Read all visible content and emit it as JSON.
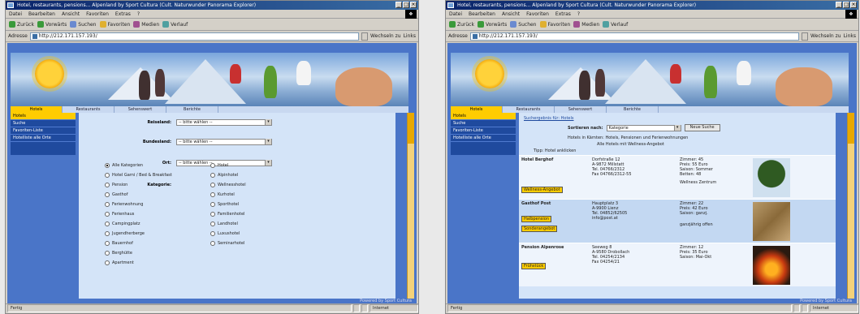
{
  "window_a": {
    "title": "Hotel, restaurants, pensions... Alpenland by Sport Cultura (Cult. Naturwunder Panorama Explorer)",
    "menu": [
      "Datei",
      "Bearbeiten",
      "Ansicht",
      "Favoriten",
      "Extras",
      "?"
    ],
    "toolbar": [
      "Zurück",
      "Vorwärts",
      "Suchen",
      "Favoriten",
      "Medien",
      "Verlauf"
    ],
    "address_label": "Adresse",
    "address_value": "http://212.171.157.193/",
    "go_label": "Wechseln zu",
    "links_label": "Links",
    "nav_tabs": [
      "Hotels",
      "Restaurants",
      "Sehenswert",
      "Berichte"
    ],
    "sidebar": [
      "Hotels",
      "Suche",
      "Favoriten-Liste",
      "Hotelliste alle Orte"
    ],
    "form": {
      "fields": [
        {
          "label": "Reiseland:",
          "value": "-- bitte wählen --"
        },
        {
          "label": "Bundesland:",
          "value": "-- bitte wählen --"
        },
        {
          "label": "Ort:",
          "value": "-- bitte wählen --"
        }
      ],
      "category_label": "Kategorie:",
      "radios_left": [
        "Alle Kategorien",
        "Hotel Garni / Bed & Breakfast",
        "Pension",
        "Gasthof",
        "Ferienwohnung",
        "Ferienhaus",
        "Campingplatz",
        "Jugendherberge",
        "Bauernhof",
        "Berghütte",
        "Apartment"
      ],
      "radios_right": [
        "Hotel",
        "Alpinhotel",
        "Wellnesshotel",
        "Kurhotel",
        "Sporthotel",
        "Familienhotel",
        "Landhotel",
        "Luxushotel",
        "Seminarhotel"
      ]
    },
    "footer": "Powered by Sport Cultura",
    "status": [
      "Fertig",
      "Internet"
    ]
  },
  "window_b": {
    "title": "Hotel, restaurants, pensions... Alpenland by Sport Cultura (Cult. Naturwunder Panorama Explorer)",
    "menu": [
      "Datei",
      "Bearbeiten",
      "Ansicht",
      "Favoriten",
      "Extras",
      "?"
    ],
    "toolbar": [
      "Zurück",
      "Vorwärts",
      "Suchen",
      "Favoriten",
      "Medien",
      "Verlauf"
    ],
    "address_label": "Adresse",
    "address_value": "http://212.171.157.193/",
    "go_label": "Wechseln zu",
    "links_label": "Links",
    "nav_tabs": [
      "Hotels",
      "Restaurants",
      "Sehenswert",
      "Berichte"
    ],
    "sidebar": [
      "Hotels",
      "Suche",
      "Favoriten-Liste",
      "Hotelliste alle Orte"
    ],
    "breadcrumb": "Suchergebnis für: Hotels",
    "sort_label": "Sortieren nach:",
    "sort_value": "Kategorie",
    "new_search_label": "Neue Suche",
    "info_lines": [
      "Hotels in Kärnten: Hotels, Pensionen und Ferienwohnungen",
      "Alle Hotels mit Wellness-Angebot",
      "Tipp: Hotel anklicken"
    ],
    "listings": [
      {
        "name": "Hotel Berghof",
        "tag": "Wellness-Angebot",
        "address": [
          "Dorfstraße 12",
          "A-9872 Millstatt",
          "Tel. 04766/2312",
          "Fax 04766/2312-55"
        ],
        "prices": [
          "Zimmer: 45",
          "Preis: 55 Euro",
          "Saison: Sommer",
          "Betten: 48"
        ],
        "extra": "Wellness Zentrum"
      },
      {
        "name": "Gasthof Post",
        "tag": "Halbpension",
        "tag2": "Sonderangebot",
        "address": [
          "Hauptplatz 3",
          "A-9900 Lienz",
          "Tel. 04852/62505",
          "info@post.at"
        ],
        "prices": [
          "Zimmer: 22",
          "Preis: 42 Euro",
          "Saison: ganzj."
        ],
        "extra": "ganzjährig offen"
      },
      {
        "name": "Pension Alpenrose",
        "tag": "Frühstück",
        "address": [
          "Seeweg 8",
          "A-9580 Drobollach",
          "Tel. 04254/2134",
          "Fax 04254/21"
        ],
        "prices": [
          "Zimmer: 12",
          "Preis: 35 Euro",
          "Saison: Mai-Okt"
        ],
        "extra": ""
      }
    ],
    "footer": "Powered by Sport Cultura",
    "status": [
      "Fertig",
      "Internet"
    ]
  }
}
